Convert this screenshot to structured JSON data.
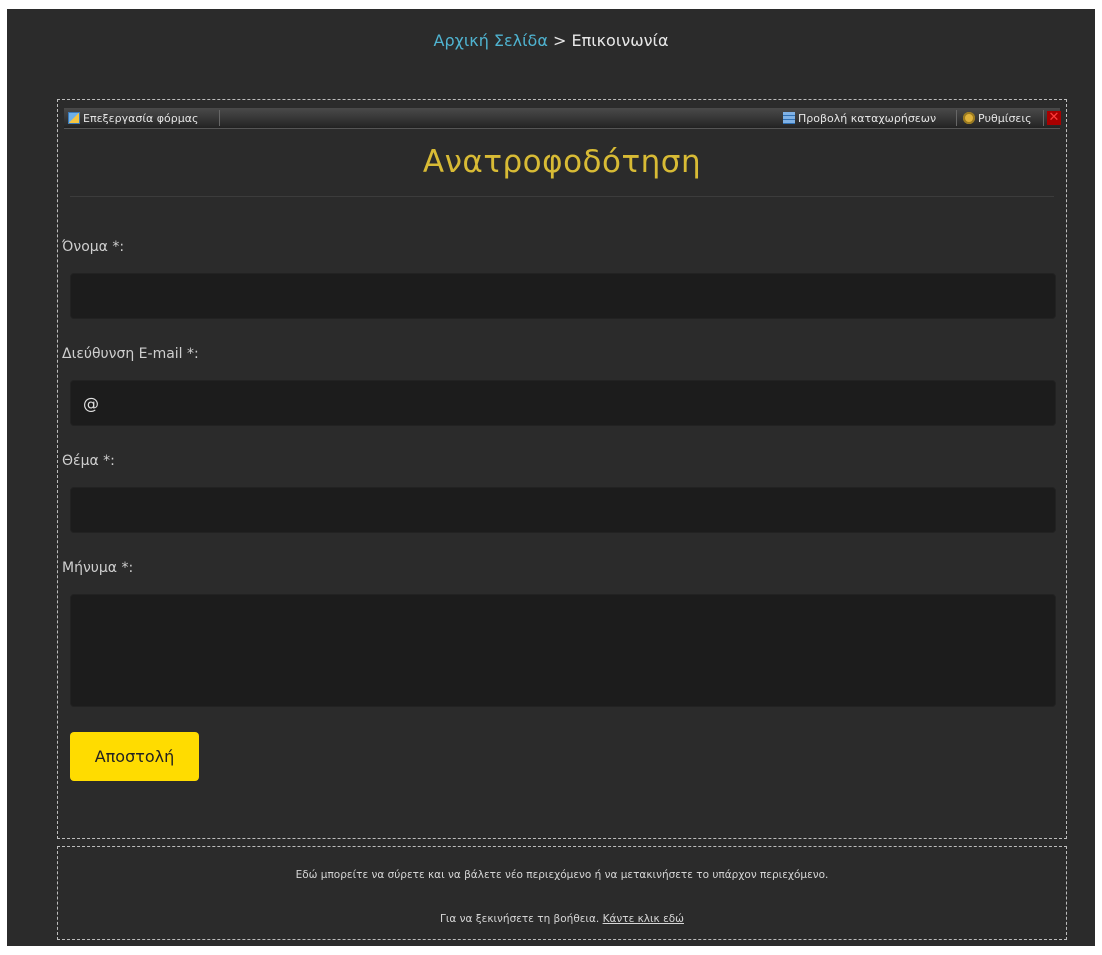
{
  "breadcrumb": {
    "home": "Αρχική Σελίδα",
    "separator": " > ",
    "current": "Επικοινωνία"
  },
  "toolbar": {
    "edit_form": "Επεξεργασία φόρμας",
    "view_entries": "Προβολή καταχωρήσεων",
    "settings": "Ρυθμίσεις",
    "close": "✕"
  },
  "form": {
    "title": "Ανατροφοδότηση",
    "fields": {
      "name": {
        "label": "Όνομα *:",
        "value": ""
      },
      "email": {
        "label": "Διεύθυνση E-mail *:",
        "value": "@"
      },
      "subject": {
        "label": "Θέμα *:",
        "value": ""
      },
      "message": {
        "label": "Μήνυμα  *:",
        "value": ""
      }
    },
    "submit_label": "Αποστολή"
  },
  "dropzone": {
    "line1": "Εδώ μπορείτε να σύρετε και να βάλετε νέο περιεχόμενο ή να μετακινήσετε το υπάρχον περιεχόμενο.",
    "line2_prefix": "Για να ξεκινήσετε τη βοήθεια. ",
    "line2_link": "Κάντε κλικ εδώ"
  },
  "colors": {
    "background": "#2b2b2b",
    "title": "#d8bb35",
    "link": "#4fb3d0",
    "button": "#ffdc00",
    "field": "#1c1c1c"
  },
  "icons": [
    "edit-icon",
    "entries-list-icon",
    "settings-gear-icon",
    "close-icon"
  ]
}
